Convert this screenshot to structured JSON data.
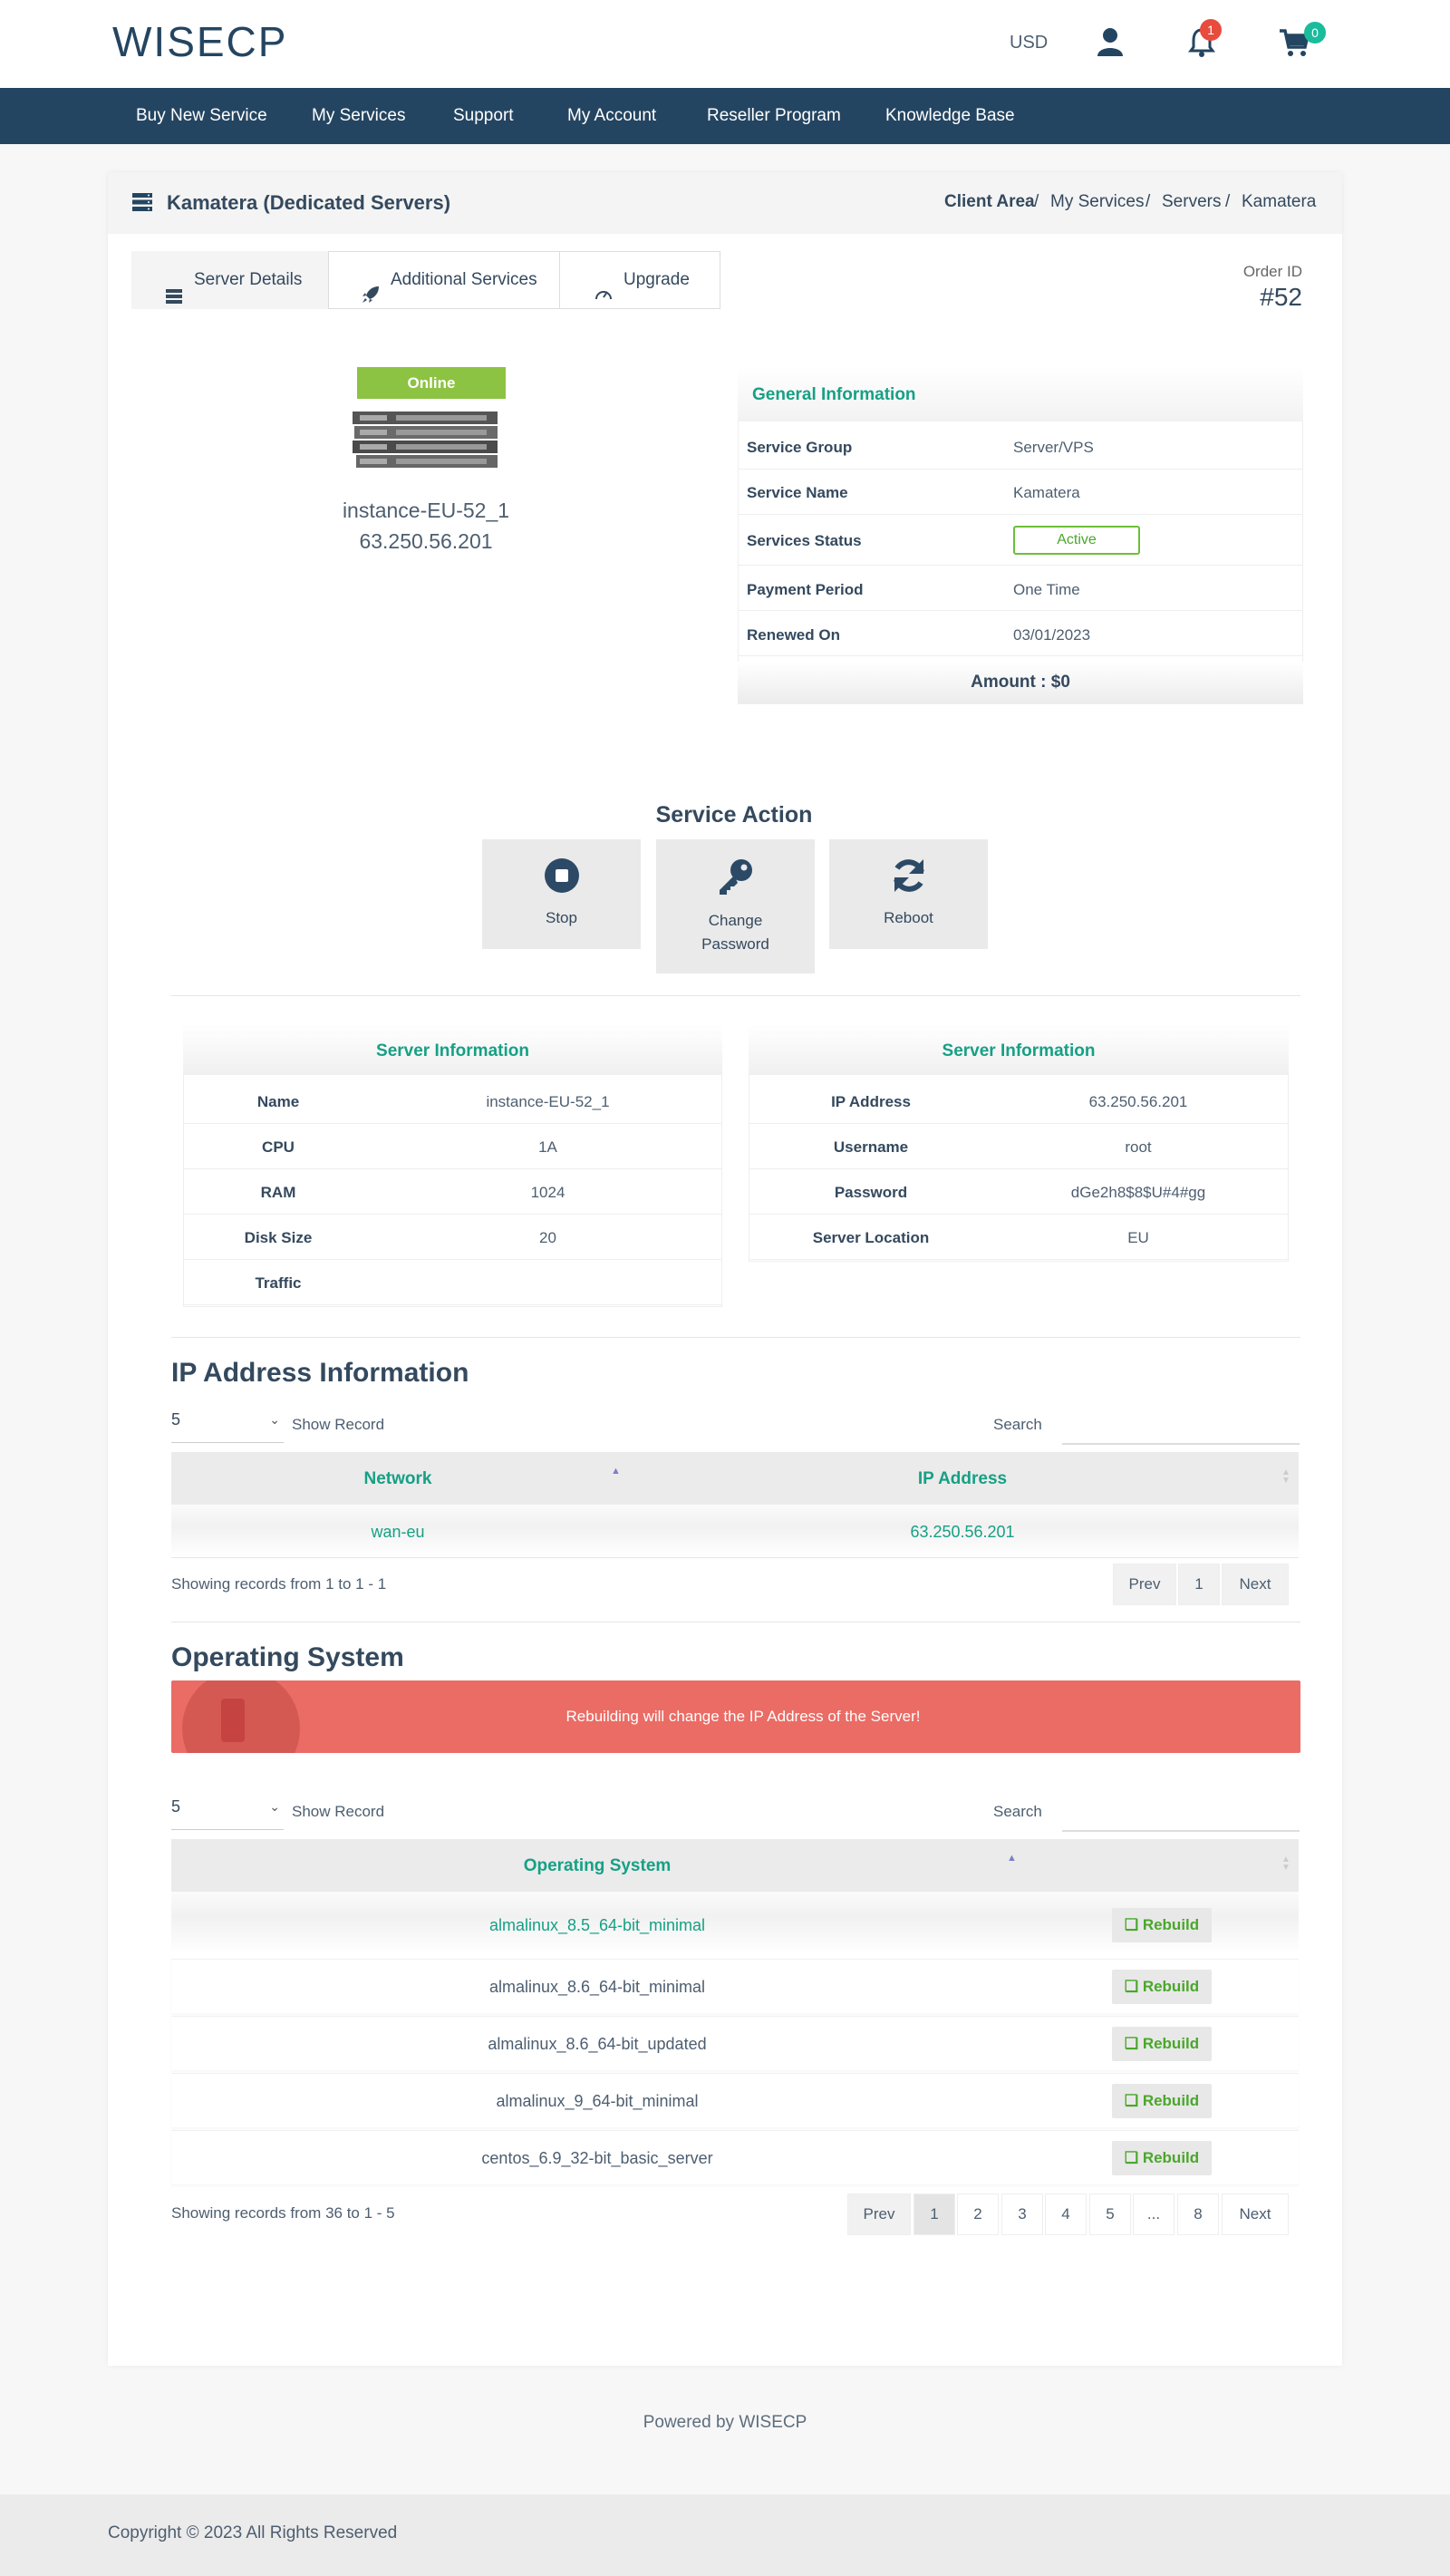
{
  "header": {
    "logo": "WISECP",
    "currency": "USD",
    "notifications_count": "1",
    "cart_count": "0",
    "colors": {
      "nav_bg": "#244561",
      "accent": "#16a085",
      "badge_red": "#e74c3c",
      "badge_cyan": "#1abc9c"
    }
  },
  "nav": {
    "items": [
      "Buy New Service",
      "My Services",
      "Support",
      "My Account",
      "Reseller Program",
      "Knowledge Base"
    ]
  },
  "page": {
    "title": "Kamatera (Dedicated Servers)",
    "breadcrumb": [
      "Client Area",
      "My Services",
      "Servers",
      "Kamatera"
    ],
    "crumb_sep": "/",
    "tabs": [
      "Server Details",
      "Additional Services",
      "Upgrade"
    ],
    "order_label": "Order ID",
    "order_id": "#52"
  },
  "server_card": {
    "status": "Online",
    "instance": "instance-EU-52_1",
    "ip": "63.250.56.201"
  },
  "general_info": {
    "title": "General Information",
    "rows": [
      {
        "k": "Service Group",
        "v": "Server/VPS"
      },
      {
        "k": "Service Name",
        "v": "Kamatera"
      },
      {
        "k": "Services Status",
        "v": "Active"
      },
      {
        "k": "Payment Period",
        "v": "One Time"
      },
      {
        "k": "Renewed On",
        "v": "03/01/2023"
      }
    ],
    "amount": "Amount : $0"
  },
  "service_action": {
    "title": "Service Action",
    "buttons": [
      {
        "label": "Stop",
        "icon": "stop-icon"
      },
      {
        "label": "Change Password",
        "icon": "key-icon"
      },
      {
        "label": "Reboot",
        "icon": "refresh-icon"
      }
    ]
  },
  "server_info_left": {
    "title": "Server Information",
    "rows": [
      {
        "k": "Name",
        "v": "instance-EU-52_1"
      },
      {
        "k": "CPU",
        "v": "1A"
      },
      {
        "k": "RAM",
        "v": "1024"
      },
      {
        "k": "Disk Size",
        "v": "20"
      },
      {
        "k": "Traffic",
        "v": ""
      }
    ]
  },
  "server_info_right": {
    "title": "Server Information",
    "rows": [
      {
        "k": "IP Address",
        "v": "63.250.56.201"
      },
      {
        "k": "Username",
        "v": "root"
      },
      {
        "k": "Password",
        "v": "dGe2h8$8$U#4#gg"
      },
      {
        "k": "Server Location",
        "v": "EU"
      }
    ]
  },
  "ip_section": {
    "title": "IP Address Information",
    "page_size": "5",
    "show_record": "Show Record",
    "search_label": "Search",
    "columns": [
      "Network",
      "IP Address"
    ],
    "rows": [
      {
        "network": "wan-eu",
        "ip": "63.250.56.201"
      }
    ],
    "showing": "Showing records from 1 to 1 - 1",
    "pager": [
      "Prev",
      "1",
      "Next"
    ]
  },
  "os_section": {
    "title": "Operating System",
    "alert": "Rebuilding will change the IP Address of the Server!",
    "page_size": "5",
    "show_record": "Show Record",
    "search_label": "Search",
    "column": "Operating System",
    "rebuild_label": "Rebuild",
    "rows": [
      "almalinux_8.5_64-bit_minimal",
      "almalinux_8.6_64-bit_minimal",
      "almalinux_8.6_64-bit_updated",
      "almalinux_9_64-bit_minimal",
      "centos_6.9_32-bit_basic_server"
    ],
    "showing": "Showing records from 36 to 1 - 5",
    "pager": [
      "Prev",
      "1",
      "2",
      "3",
      "4",
      "5",
      "...",
      "8",
      "Next"
    ]
  },
  "footer": {
    "powered": "Powered by WISECP",
    "copyright": "Copyright © 2023 All Rights Reserved"
  }
}
